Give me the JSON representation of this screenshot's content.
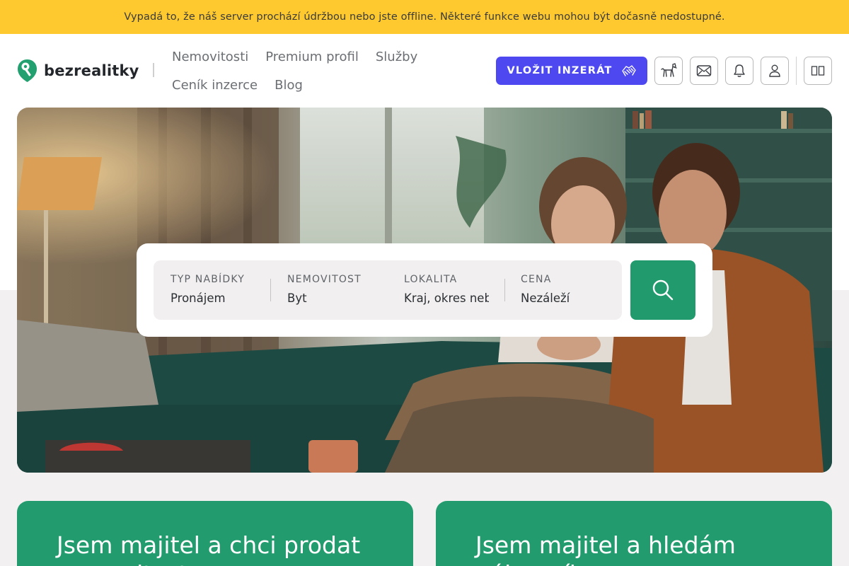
{
  "banner": {
    "text": "Vypadá to, že náš server prochází údržbou nebo jste offline. Některé funkce webu mohou být dočasně nedostupné."
  },
  "header": {
    "logo_text": "bezrealitky",
    "nav": [
      "Nemovitosti",
      "Premium profil",
      "Služby",
      "Ceník inzerce",
      "Blog"
    ],
    "cta_label": "VLOŽIT INZERÁT",
    "icons": [
      "dog-icon",
      "mail-icon",
      "bell-icon",
      "user-icon",
      "panel-icon"
    ]
  },
  "search": {
    "fields": [
      {
        "label": "TYP NABÍDKY",
        "value": "Pronájem"
      },
      {
        "label": "NEMOVITOST",
        "value": "Byt"
      },
      {
        "label": "LOKALITA",
        "value": "Kraj, okres nebo obec"
      },
      {
        "label": "CENA",
        "value": "Nezáleží"
      }
    ],
    "button_icon": "search-icon"
  },
  "cards": [
    {
      "title": "Jsem majitel a chci prodat nemovitost"
    },
    {
      "title": "Jsem majitel a hledám nájemníka"
    }
  ],
  "colors": {
    "banner": "#fdc92f",
    "primary_cta": "#4d48f0",
    "brand_green": "#219b6e"
  }
}
